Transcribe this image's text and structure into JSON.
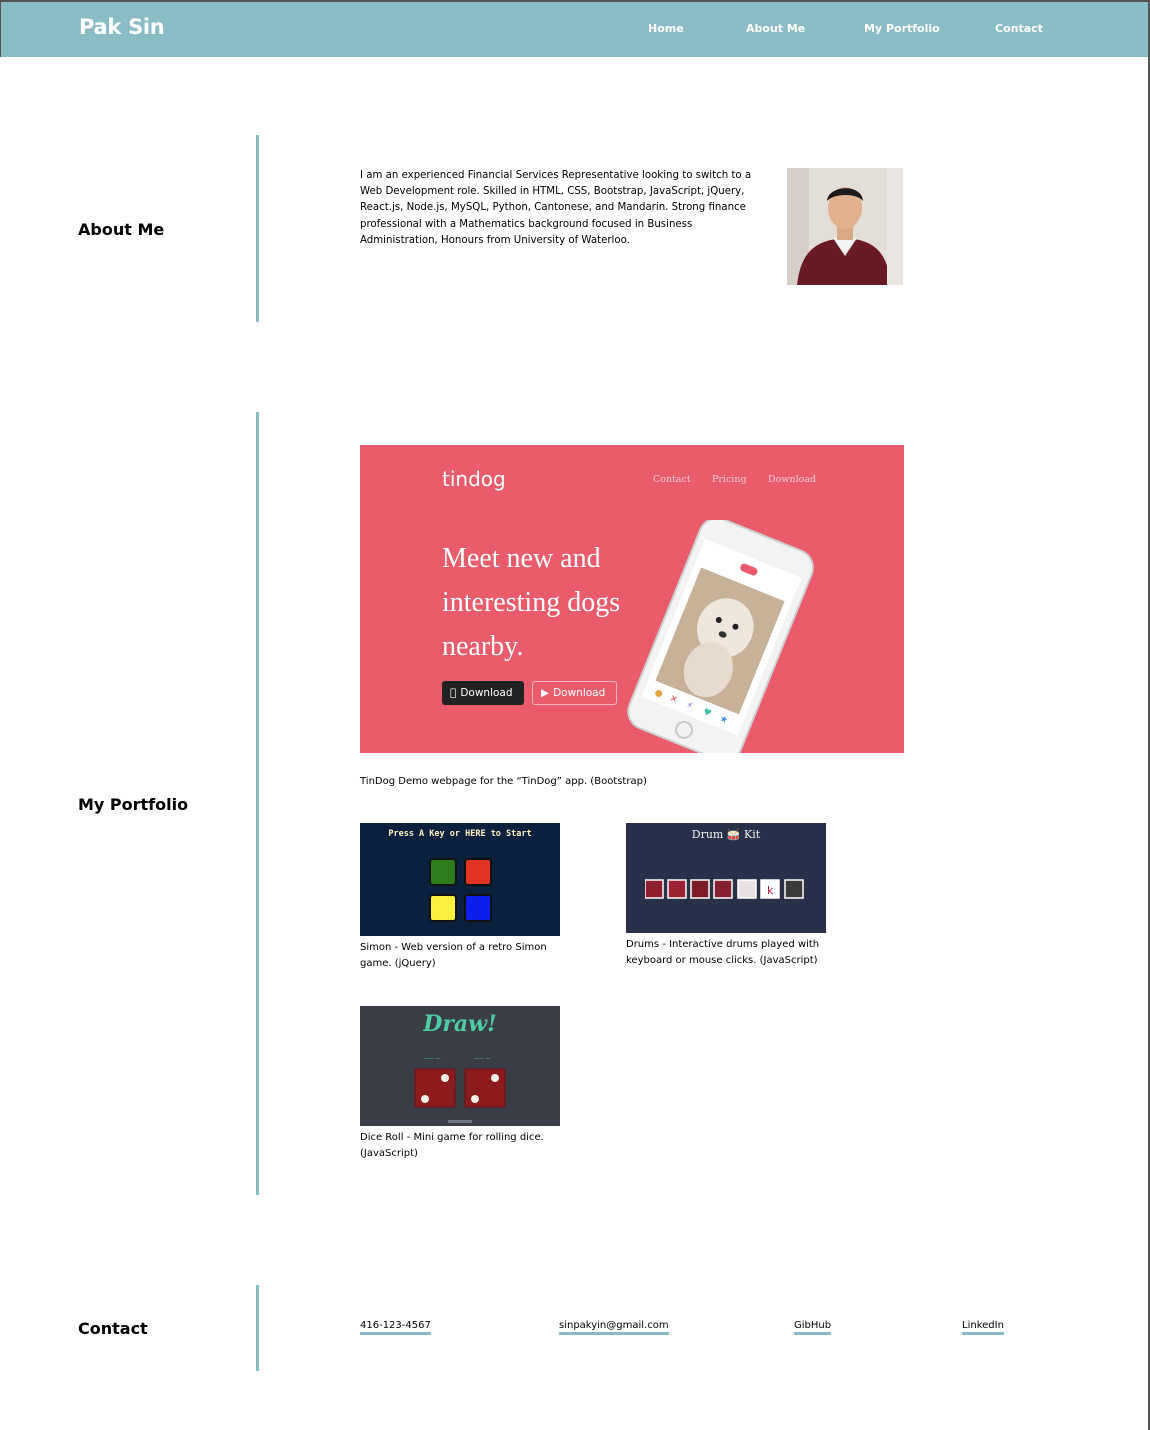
{
  "nav": {
    "brand": "Pak Sin",
    "links": [
      "Home",
      "About Me",
      "My Portfolio",
      "Contact"
    ]
  },
  "about": {
    "title": "About Me",
    "text": "I am an experienced Financial Services Representative looking to switch to a Web Development role. Skilled in HTML, CSS, Bootstrap, JavaScript, jQuery, React.js, Node.js, MySQL, Python, Cantonese, and Mandarin. Strong finance professional with a Mathematics background focused in Business Administration, Honours from University of Waterloo."
  },
  "portfolio": {
    "title": "My Portfolio",
    "tindog": {
      "logo": "tindog",
      "nav": [
        "Contact",
        "Pricing",
        "Download"
      ],
      "headline": "Meet new and interesting dogs nearby.",
      "btn_apple": "Download",
      "btn_play": "Download",
      "caption": "TinDog Demo webpage for the “TinDog” app. (Bootstrap)"
    },
    "simon": {
      "screen_text": "Press A Key or HERE to Start",
      "caption": "Simon - Web version of a retro Simon game. (jQuery)"
    },
    "drums": {
      "screen_text": "Drum 🥁 Kit",
      "caption": "Drums - Interactive drums played with keyboard or mouse clicks. (JavaScript)"
    },
    "dice": {
      "screen_text": "Draw!",
      "caption": "Dice Roll - Mini game for rolling dice. (JavaScript)"
    }
  },
  "contact": {
    "title": "Contact",
    "phone": "416-123-4567",
    "email": "sinpakyin@gmail.com",
    "github": "GibHub",
    "linkedin": "LinkedIn"
  },
  "colors": {
    "accent": "#89bcc4",
    "tindog_red": "#ea5b6b",
    "simon_bg": "#0b1f3f",
    "drum_bg": "#283149",
    "dice_bg": "#393e46"
  }
}
